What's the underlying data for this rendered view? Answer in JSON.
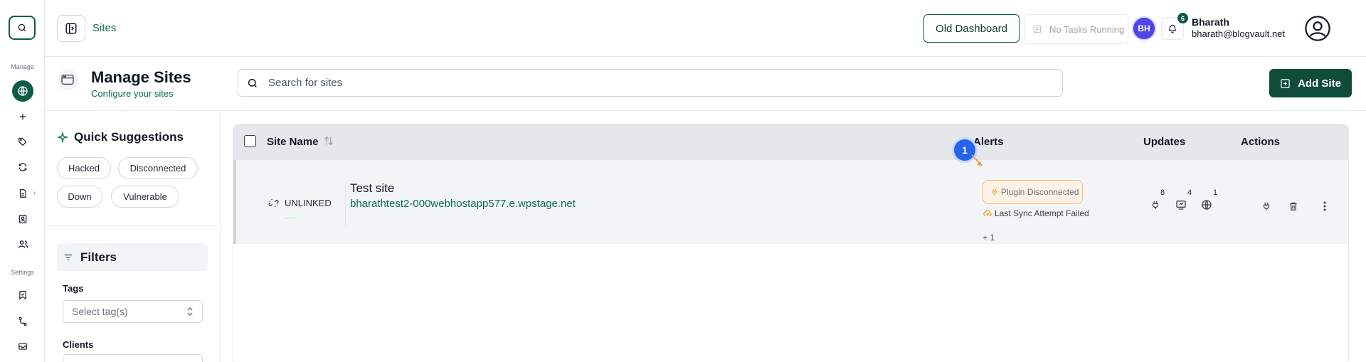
{
  "topbar": {
    "breadcrumb": "Sites",
    "old_dashboard_label": "Old Dashboard",
    "tasks_label": "No Tasks Running",
    "avatar_initials": "BH",
    "notification_count": "6",
    "user_name": "Bharath",
    "user_email": "bharath@blogvault.net"
  },
  "rail": {
    "manage_label": "Manage",
    "settings_label": "Settings",
    "icons": [
      "search-icon",
      "globe-icon",
      "plus-icon",
      "tags-icon",
      "sync-icon",
      "document-icon",
      "contact-icon",
      "users-icon",
      "bookmark-icon",
      "route-icon",
      "mail-icon"
    ]
  },
  "page": {
    "title": "Manage Sites",
    "subtitle": "Configure your sites",
    "search_placeholder": "Search for sites",
    "add_site_label": "Add Site"
  },
  "quick_suggestions": {
    "title": "Quick Suggestions",
    "chips": [
      "Hacked",
      "Disconnected",
      "Down",
      "Vulnerable"
    ]
  },
  "filters": {
    "title": "Filters",
    "tags_label": "Tags",
    "tags_placeholder": "Select tag(s)",
    "clients_label": "Clients"
  },
  "table": {
    "columns": {
      "site_name": "Site Name",
      "alerts": "Alerts",
      "updates": "Updates",
      "actions": "Actions"
    },
    "rows": [
      {
        "status": "UNLINKED",
        "name": "Test site",
        "url": "bharathtest2-000webhostapp577.e.wpstage.net",
        "alerts": [
          "Plugin Disconnected",
          "Last Sync Attempt Failed"
        ],
        "more_alerts": "+ 1",
        "updates": {
          "plugins": "8",
          "themes": "4",
          "core": "1"
        }
      }
    ]
  },
  "annotation": {
    "step": "1"
  },
  "colors": {
    "brand": "#0f5c45",
    "link": "#0f6b4e",
    "alert_border": "#fdba74",
    "step_badge": "#2563eb"
  }
}
